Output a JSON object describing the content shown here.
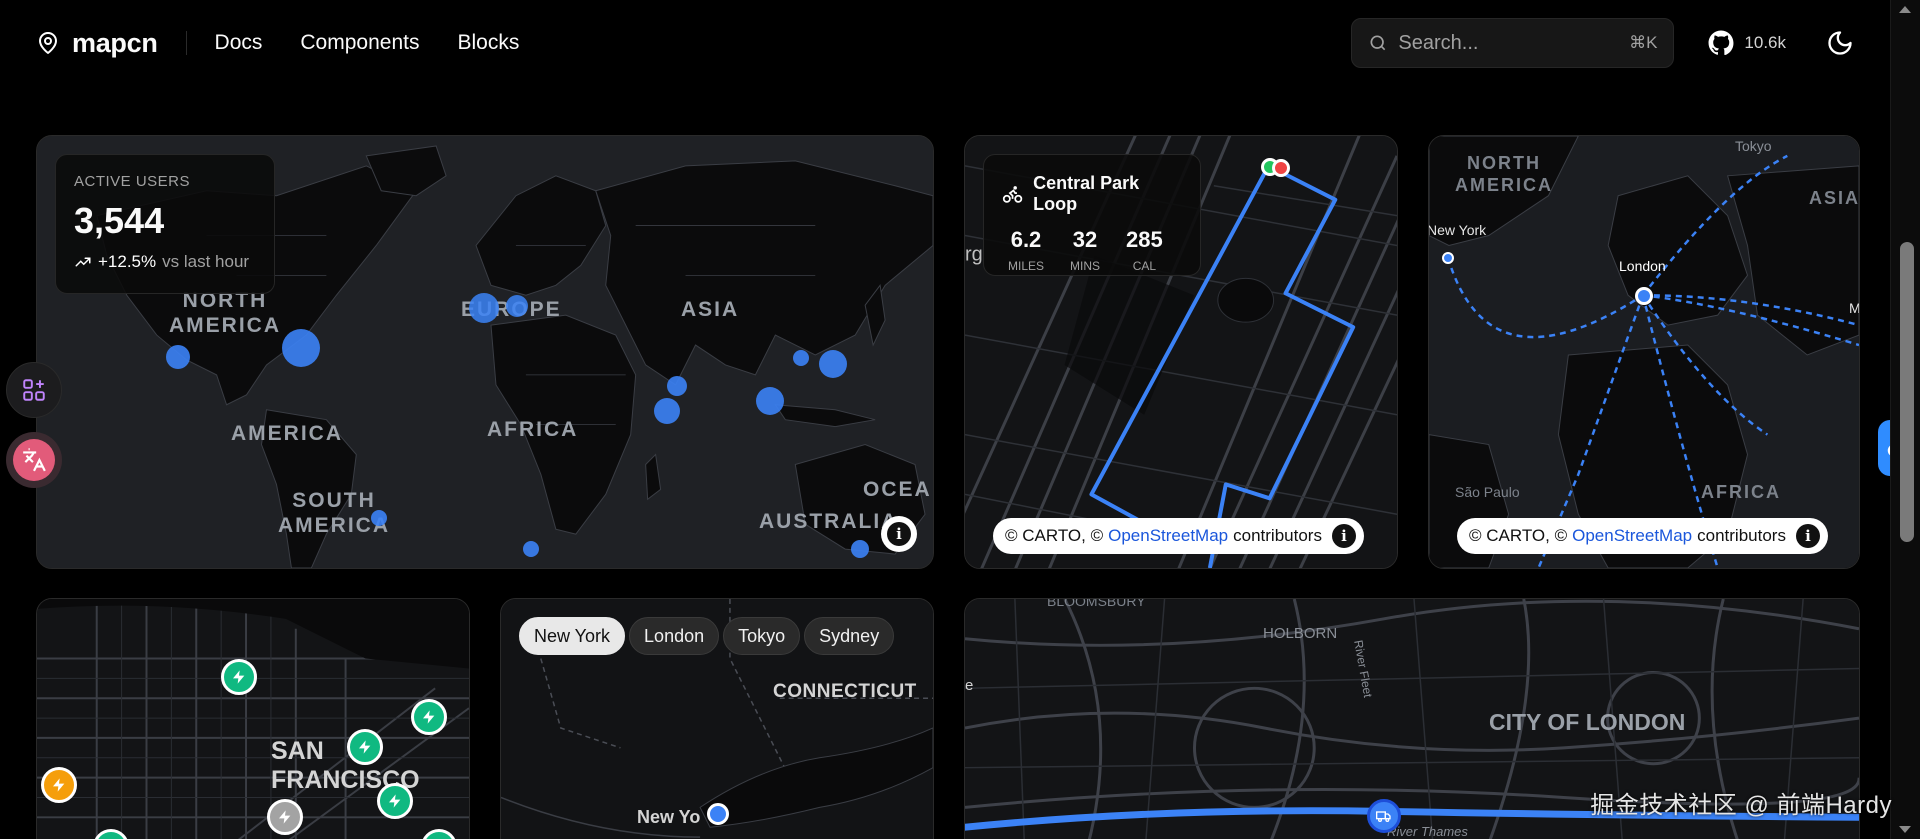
{
  "header": {
    "brand": "mapcn",
    "nav": [
      "Docs",
      "Components",
      "Blocks"
    ],
    "search_placeholder": "Search...",
    "search_shortcut": "⌘K",
    "github_stars": "10.6k"
  },
  "icons": {
    "logo": "map-pin-icon",
    "search": "search-icon",
    "github": "github-icon",
    "theme": "moon-icon",
    "trend": "trending-up-icon",
    "bike": "bike-icon",
    "info": "info-icon",
    "charging": "lightning-icon",
    "truck": "truck-icon"
  },
  "colors": {
    "accent": "#3b82f6",
    "green": "#10b981",
    "orange": "#f59e0b",
    "map_land": "#1f2125",
    "route": "#3b82f6"
  },
  "active_users": {
    "label": "ACTIVE USERS",
    "value": "3,544",
    "change": "+12.5%",
    "suffix": "vs last hour"
  },
  "world_labels": [
    "NORTH AMERICA",
    "EUROPE",
    "ASIA",
    "AMERICA",
    "AFRICA",
    "SOUTH AMERICA",
    "AUSTRALIA",
    "OCEA"
  ],
  "route_card": {
    "title": "Central Park Loop",
    "stats": [
      {
        "value": "6.2",
        "unit": "MILES"
      },
      {
        "value": "32",
        "unit": "MINS"
      },
      {
        "value": "285",
        "unit": "CAL"
      }
    ],
    "side_label": "rg"
  },
  "attribution": {
    "prefix": "© CARTO, ©",
    "osm": "OpenStreetMap",
    "suffix": "contributors"
  },
  "globe_card": {
    "labels": [
      "NORTH AMERICA",
      "Tokyo",
      "ASIA",
      "New York",
      "London",
      "Mo",
      "São Paulo",
      "AFRICA"
    ]
  },
  "sf_card": {
    "city": "SAN FRANCISCO"
  },
  "city_card": {
    "chips": [
      "New York",
      "London",
      "Tokyo",
      "Sydney"
    ],
    "active_chip": "New York",
    "labels": [
      "CONNECTICUT",
      "New Yo"
    ]
  },
  "london_card": {
    "labels": [
      "BLOOMSBURY",
      "HOLBORN",
      "River Fleet",
      "CITY OF LONDON",
      "River Thames",
      "e"
    ]
  },
  "watermark": "掘金技术社区 @ 前端Hardy"
}
